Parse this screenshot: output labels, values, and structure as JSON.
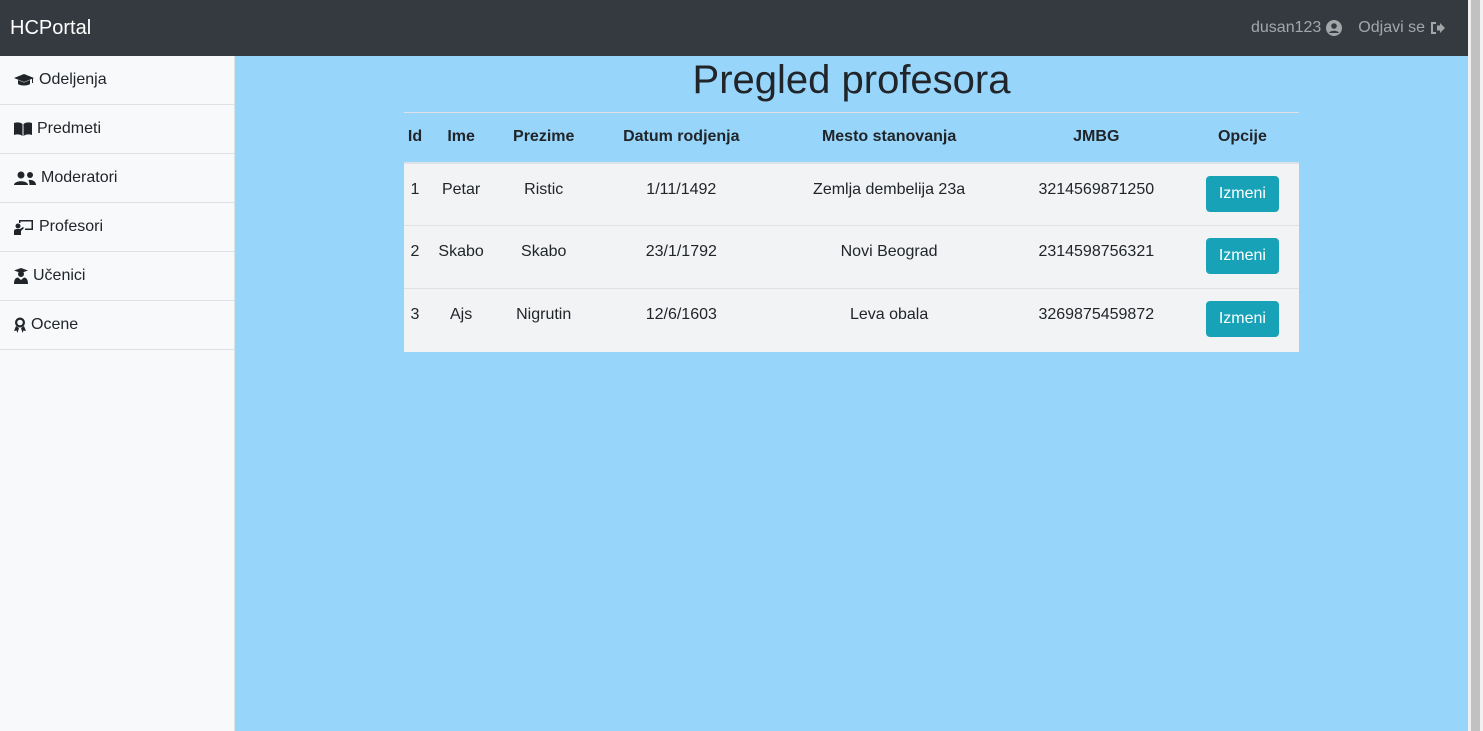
{
  "navbar": {
    "brand": "HCPortal",
    "username": "dusan123",
    "logout": "Odjavi se",
    "colors": {
      "background": "#343a40"
    }
  },
  "sidebar": {
    "items": [
      {
        "label": "Odeljenja",
        "icon": "graduation-cap-icon"
      },
      {
        "label": "Predmeti",
        "icon": "book-open-icon"
      },
      {
        "label": "Moderatori",
        "icon": "users-icon"
      },
      {
        "label": "Profesori",
        "icon": "chalkboard-teacher-icon"
      },
      {
        "label": "Učenici",
        "icon": "user-graduate-icon"
      },
      {
        "label": "Ocene",
        "icon": "award-icon"
      }
    ]
  },
  "main": {
    "title": "Pregled profesora",
    "background": "#97d5fb",
    "table": {
      "headers": [
        "Id",
        "Ime",
        "Prezime",
        "Datum rodjenja",
        "Mesto stanovanja",
        "JMBG",
        "Opcije"
      ],
      "rows": [
        {
          "id": "1",
          "ime": "Petar",
          "prezime": "Ristic",
          "datum": "1/11/1492",
          "mesto": "Zemlja dembelija 23a",
          "jmbg": "3214569871250",
          "action": "Izmeni"
        },
        {
          "id": "2",
          "ime": "Skabo",
          "prezime": "Skabo",
          "datum": "23/1/1792",
          "mesto": "Novi Beograd",
          "jmbg": "2314598756321",
          "action": "Izmeni"
        },
        {
          "id": "3",
          "ime": "Ajs",
          "prezime": "Nigrutin",
          "datum": "12/6/1603",
          "mesto": "Leva obala",
          "jmbg": "3269875459872",
          "action": "Izmeni"
        }
      ]
    },
    "button_color": "#17a2b8"
  }
}
